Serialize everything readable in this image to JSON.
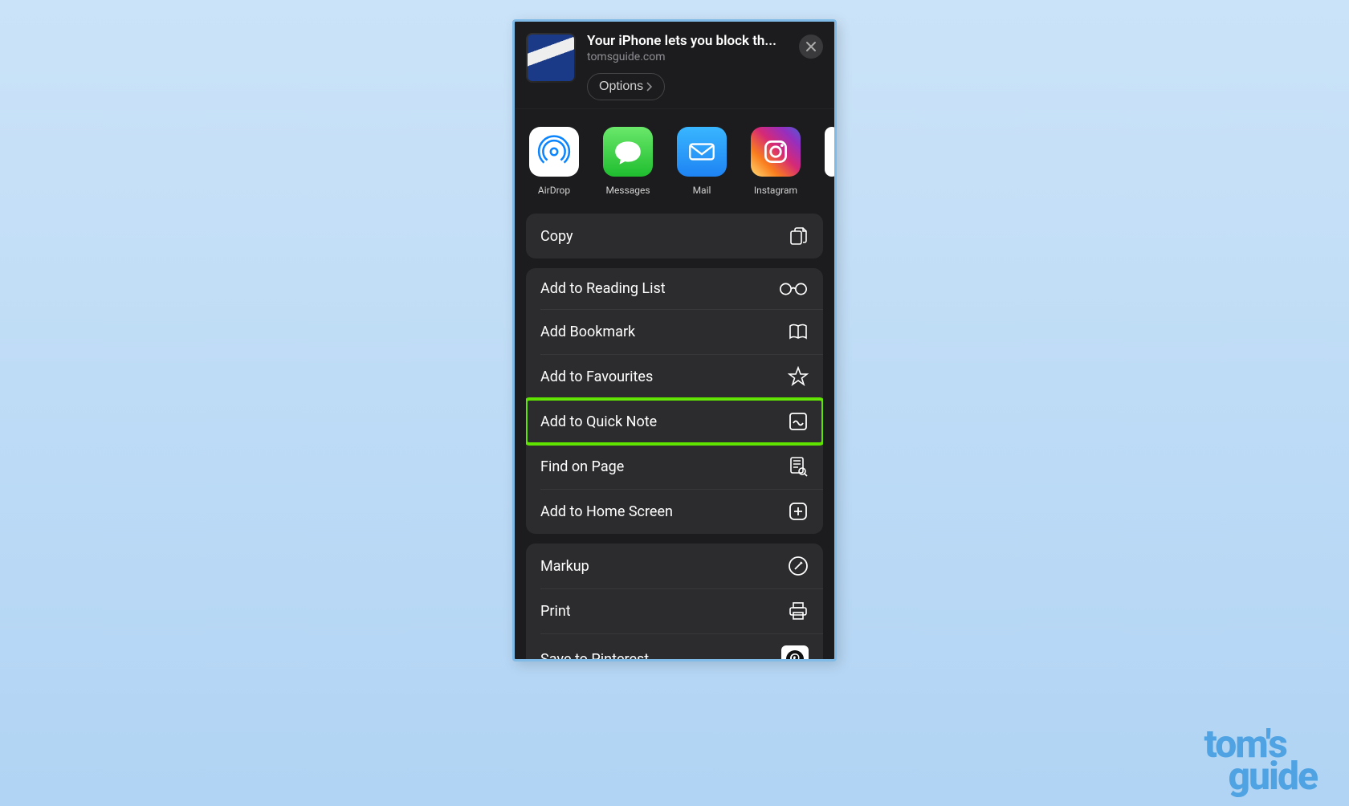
{
  "header": {
    "title": "Your iPhone lets you block th...",
    "domain": "tomsguide.com",
    "options_label": "Options"
  },
  "targets": [
    {
      "id": "airdrop",
      "label": "AirDrop"
    },
    {
      "id": "messages",
      "label": "Messages"
    },
    {
      "id": "mail",
      "label": "Mail"
    },
    {
      "id": "instagram",
      "label": "Instagram"
    }
  ],
  "actions": {
    "group1": [
      {
        "id": "copy",
        "label": "Copy",
        "icon": "copy"
      }
    ],
    "group2": [
      {
        "id": "reading-list",
        "label": "Add to Reading List",
        "icon": "glasses"
      },
      {
        "id": "bookmark",
        "label": "Add Bookmark",
        "icon": "book"
      },
      {
        "id": "favourites",
        "label": "Add to Favourites",
        "icon": "star"
      },
      {
        "id": "quick-note",
        "label": "Add to Quick Note",
        "icon": "quicknote",
        "highlight": true
      },
      {
        "id": "find",
        "label": "Find on Page",
        "icon": "find"
      },
      {
        "id": "home-screen",
        "label": "Add to Home Screen",
        "icon": "plusapp"
      }
    ],
    "group3": [
      {
        "id": "markup",
        "label": "Markup",
        "icon": "markup"
      },
      {
        "id": "print",
        "label": "Print",
        "icon": "printer"
      },
      {
        "id": "pinterest",
        "label": "Save to Pinterest",
        "icon": "pinterest"
      }
    ]
  },
  "watermark": {
    "line1": "tom's",
    "line2": "guide"
  }
}
